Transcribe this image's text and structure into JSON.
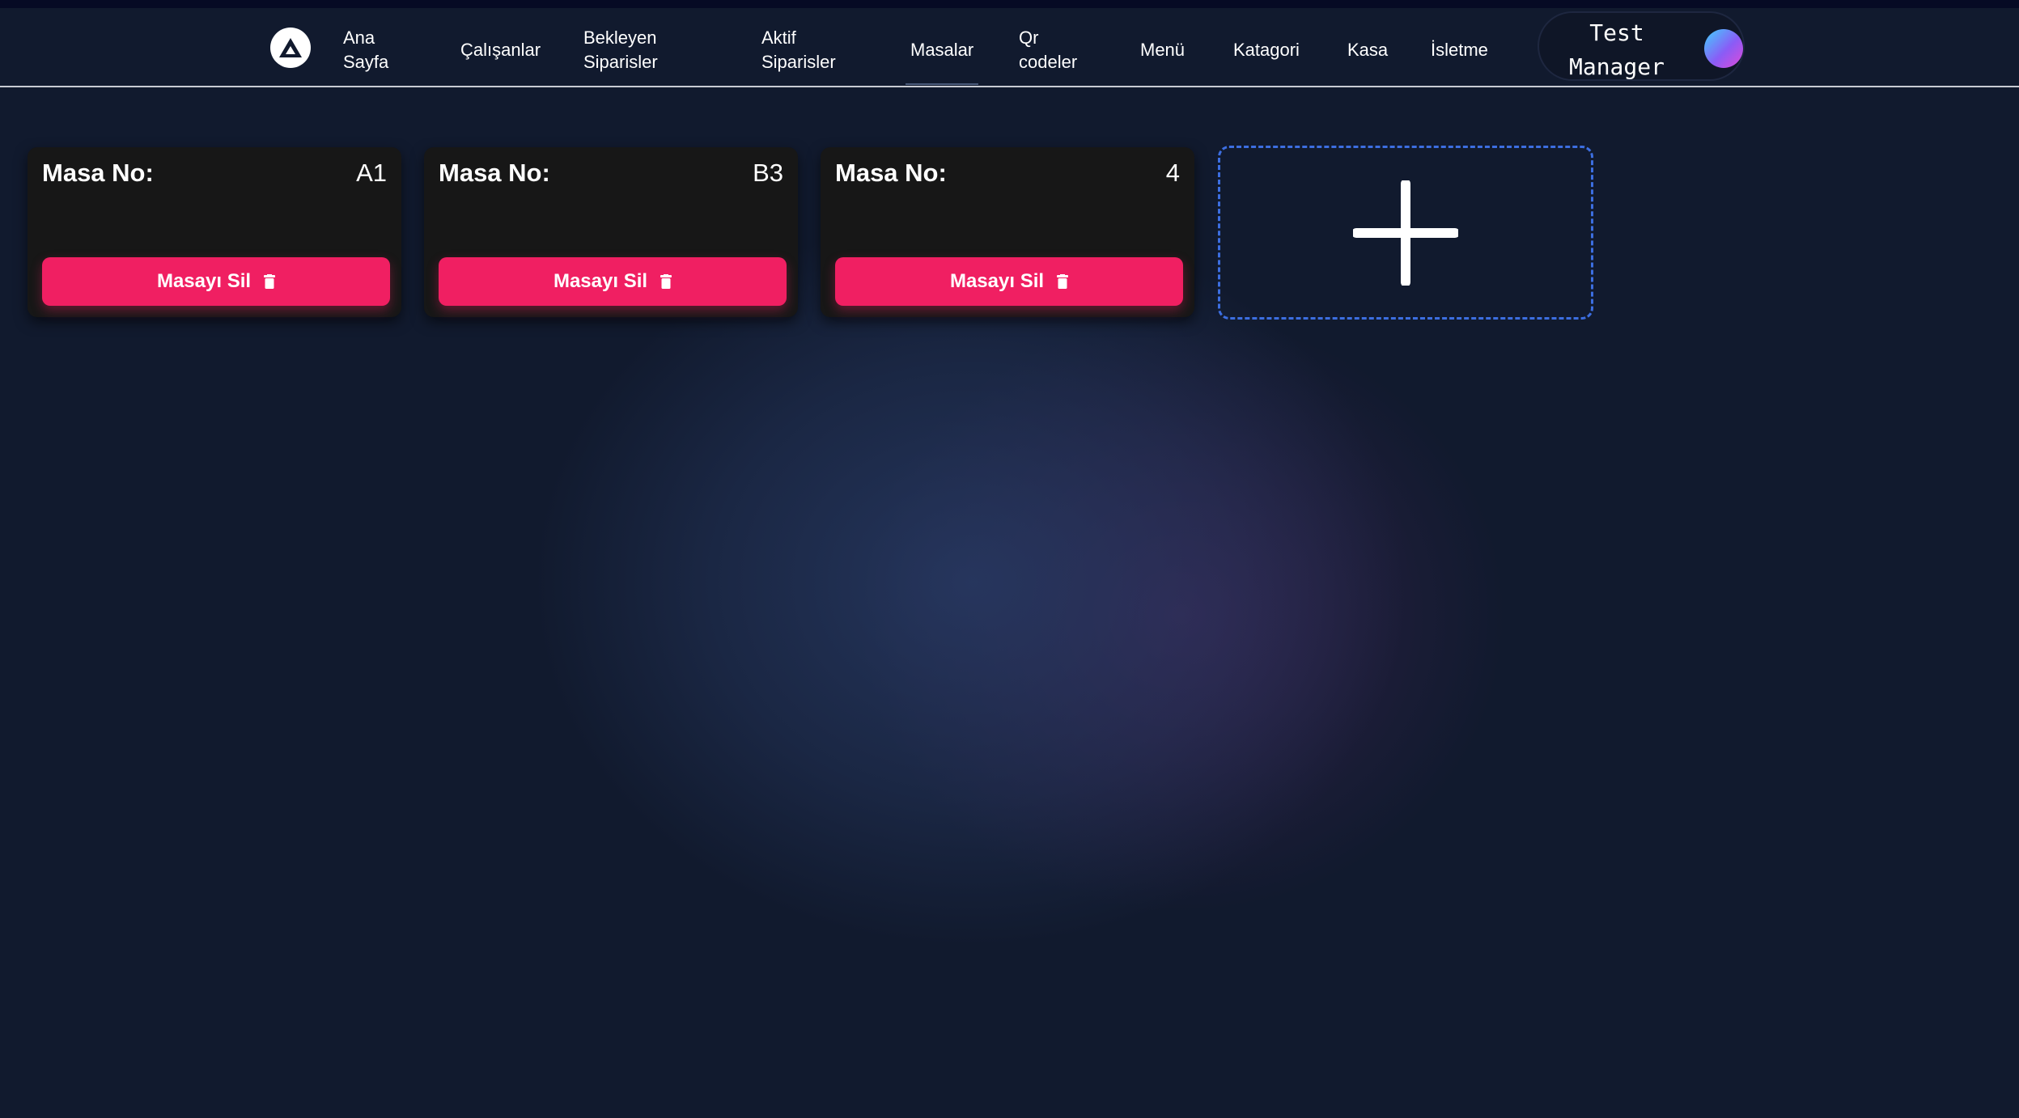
{
  "nav": {
    "items": [
      {
        "label_line1": "Ana",
        "label_line2": "Sayfa"
      },
      {
        "label": "Çalışanlar"
      },
      {
        "label_line1": "Bekleyen",
        "label_line2": "Siparisler"
      },
      {
        "label_line1": "Aktif",
        "label_line2": "Siparisler"
      },
      {
        "label": "Masalar"
      },
      {
        "label_line1": "Qr",
        "label_line2": "codeler"
      },
      {
        "label": "Menü"
      },
      {
        "label": "Katagori"
      },
      {
        "label": "Kasa"
      },
      {
        "label": "İsletme"
      }
    ],
    "active": "Masalar",
    "logo_icon": "logo-triangle-icon"
  },
  "user": {
    "name_line1": "Test",
    "name_line2": "Manager",
    "avatar_icon": "avatar-gradient-circle"
  },
  "tables": [
    {
      "label": "Masa No:",
      "number": "A1",
      "delete_label": "Masayı Sil"
    },
    {
      "label": "Masa No:",
      "number": "B3",
      "delete_label": "Masayı Sil"
    },
    {
      "label": "Masa No:",
      "number": "4",
      "delete_label": "Masayı Sil"
    }
  ],
  "add_table": {
    "icon": "plus-icon"
  },
  "colors": {
    "background": "#111a2e",
    "card": "#171717",
    "delete_button": "#f01f62",
    "add_border": "#3c6ee0"
  }
}
